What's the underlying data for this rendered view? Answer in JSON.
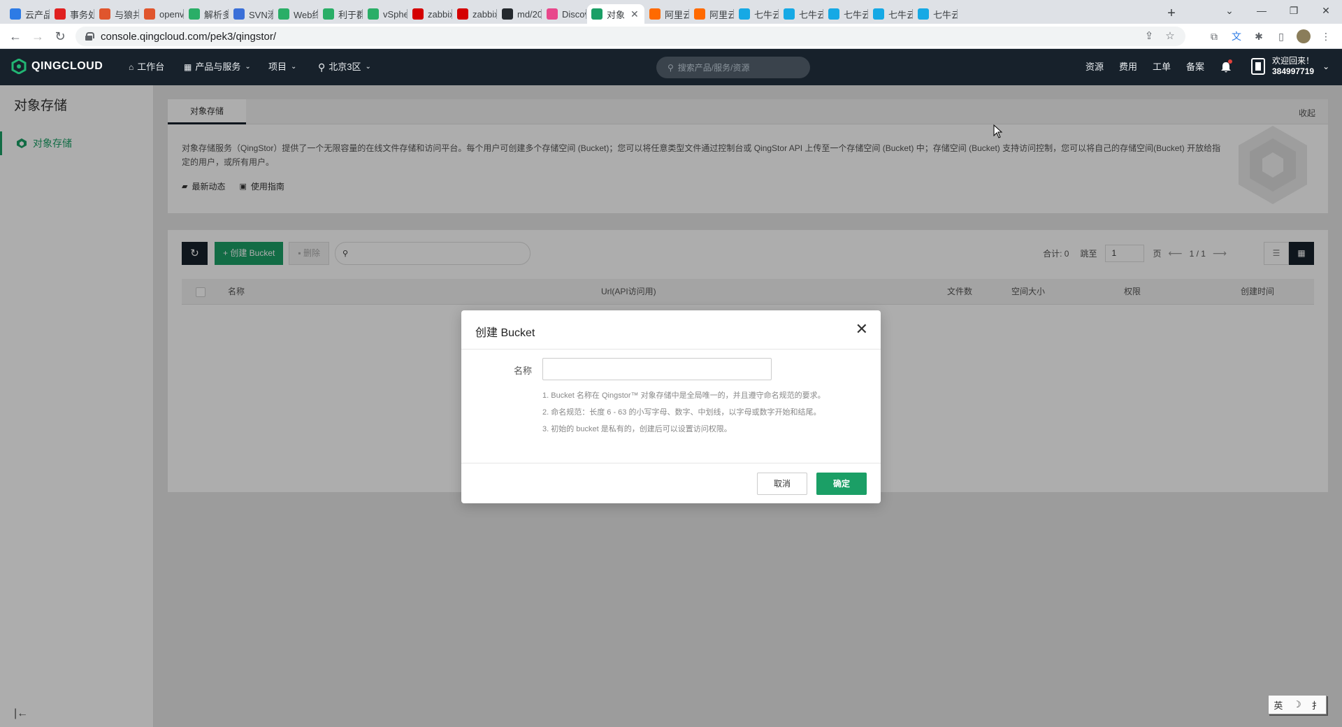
{
  "browser": {
    "tabs": [
      {
        "label": "云产品",
        "icon": "cloud-icon",
        "color": "#2d7be5"
      },
      {
        "label": "事务处",
        "icon": "huawei-icon",
        "color": "#e02020"
      },
      {
        "label": "与狼共",
        "icon": "bookmark-icon",
        "color": "#e0552d"
      },
      {
        "label": "openv",
        "icon": "bookmark-icon",
        "color": "#e0552d"
      },
      {
        "label": "解析多",
        "icon": "wechat-icon",
        "color": "#2aae67"
      },
      {
        "label": "SVN添",
        "icon": "doc-icon",
        "color": "#3a6fd8"
      },
      {
        "label": "Web终",
        "icon": "cube-icon",
        "color": "#2aae67"
      },
      {
        "label": "利于群",
        "icon": "wechat-icon",
        "color": "#2aae67"
      },
      {
        "label": "vSphe",
        "icon": "vsphere-icon",
        "color": "#2aae67"
      },
      {
        "label": "zabbix",
        "icon": "zabbix-icon",
        "color": "#d40000"
      },
      {
        "label": "zabbix",
        "icon": "zabbix-icon",
        "color": "#d40000"
      },
      {
        "label": "md/20",
        "icon": "github-icon",
        "color": "#24292e"
      },
      {
        "label": "Discov",
        "icon": "kibana-icon",
        "color": "#e8478b"
      },
      {
        "label": "对象",
        "icon": "qingcloud-icon",
        "color": "#1b9f66",
        "active": true
      },
      {
        "label": "阿里云",
        "icon": "aliyun-icon",
        "color": "#ff6a00"
      },
      {
        "label": "阿里云",
        "icon": "aliyun-icon",
        "color": "#ff6a00"
      },
      {
        "label": "七牛云",
        "icon": "qiniu-icon",
        "color": "#16a9e5"
      },
      {
        "label": "七牛云",
        "icon": "qiniu-icon",
        "color": "#16a9e5"
      },
      {
        "label": "七牛云",
        "icon": "qiniu-icon",
        "color": "#16a9e5"
      },
      {
        "label": "七牛云",
        "icon": "qiniu-icon",
        "color": "#16a9e5"
      },
      {
        "label": "七牛云",
        "icon": "qiniu-icon",
        "color": "#16a9e5"
      }
    ],
    "url": "console.qingcloud.com/pek3/qingstor/"
  },
  "topnav": {
    "logo": "QINGCLOUD",
    "workbench": "工作台",
    "products": "产品与服务",
    "project": "项目",
    "region": "北京3区",
    "search_placeholder": "搜索产品/服务/资源",
    "resources": "资源",
    "billing": "费用",
    "tickets": "工单",
    "filing": "备案",
    "welcome": "欢迎回来！",
    "user_id": "384997719"
  },
  "sidebar": {
    "title": "对象存储",
    "item": "对象存储"
  },
  "intro": {
    "tab": "对象存储",
    "collapse": "收起",
    "description": "对象存储服务（QingStor）提供了一个无限容量的在线文件存储和访问平台。每个用户可创建多个存储空间 (Bucket)；您可以将任意类型文件通过控制台或 QingStor API 上传至一个存储空间 (Bucket) 中；存储空间 (Bucket) 支持访问控制，您可以将自己的存储空间(Bucket) 开放给指定的用户，或所有用户。",
    "news": "最新动态",
    "guide": "使用指南"
  },
  "toolbar": {
    "create": "创建 Bucket",
    "delete": "删除",
    "total": "合计: 0",
    "goto": "跳至",
    "page_input": "1",
    "page_unit": "页",
    "page_info": "1 / 1"
  },
  "table": {
    "headers": [
      "名称",
      "Url(API访问用)",
      "文件数",
      "空间大小",
      "权限",
      "创建时间"
    ]
  },
  "modal": {
    "title": "创建 Bucket",
    "name_label": "名称",
    "name_value": "",
    "hints": [
      "1. Bucket 名称在 Qingstor™ 对象存储中是全局唯一的，并且遵守命名规范的要求。",
      "2. 命名规范：长度 6 - 63 的小写字母、数字、中划线，以字母或数字开始和结尾。",
      "3. 初始的 bucket 是私有的，创建后可以设置访问权限。"
    ],
    "cancel": "取消",
    "confirm": "确定"
  },
  "ime": {
    "items": [
      "英",
      "☽",
      "⺘"
    ]
  }
}
